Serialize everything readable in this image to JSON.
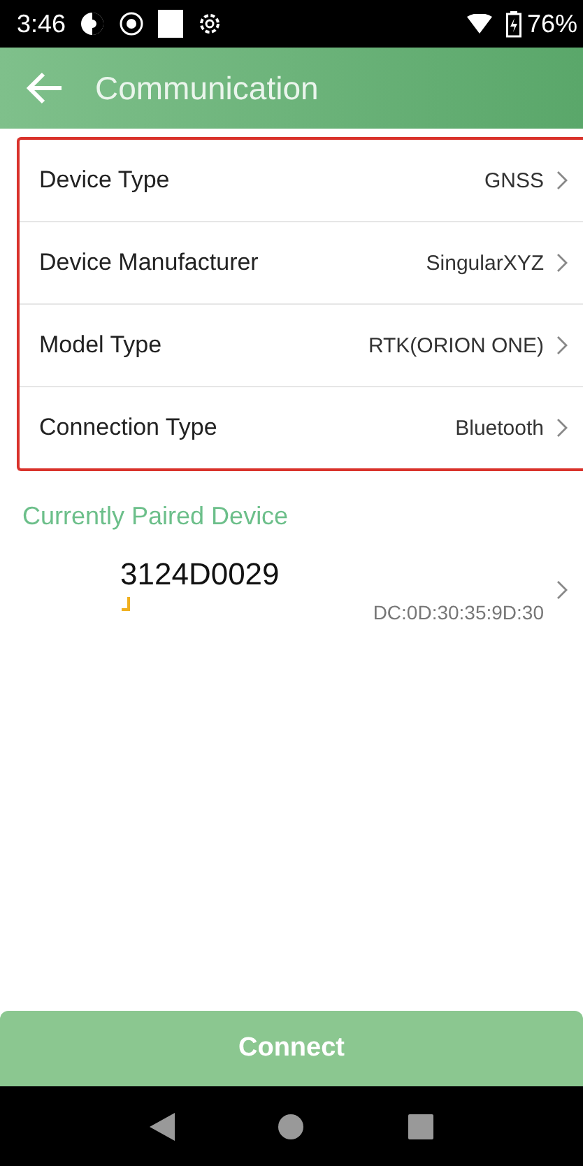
{
  "status_bar": {
    "time": "3:46",
    "battery": "76%"
  },
  "app_bar": {
    "title": "Communication"
  },
  "settings": [
    {
      "label": "Device Type",
      "value": "GNSS"
    },
    {
      "label": "Device Manufacturer",
      "value": "SingularXYZ"
    },
    {
      "label": "Model Type",
      "value": "RTK(ORION ONE)"
    },
    {
      "label": "Connection Type",
      "value": "Bluetooth"
    }
  ],
  "paired_section": {
    "title": "Currently Paired Device",
    "device": {
      "name": "3124D0029",
      "address": "DC:0D:30:35:9D:30"
    }
  },
  "connect_button": "Connect"
}
